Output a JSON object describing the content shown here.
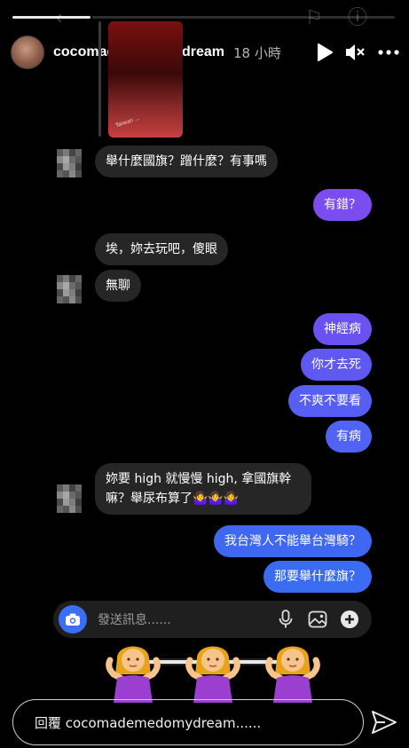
{
  "header": {
    "username": "cocomademedomydream",
    "time": "18 小時"
  },
  "messages": [
    {
      "side": "in",
      "text": "舉什麼國旗？蹭什麼？有事嗎"
    },
    {
      "side": "out",
      "text": "有錯？"
    },
    {
      "side": "in",
      "text": "埃，妳去玩吧，傻眼"
    },
    {
      "side": "in",
      "text": "無聊"
    },
    {
      "side": "out",
      "text": "神經病"
    },
    {
      "side": "out",
      "text": "你才去死"
    },
    {
      "side": "out",
      "text": "不爽不要看"
    },
    {
      "side": "out",
      "text": "有病"
    },
    {
      "side": "in",
      "text": "妳要 high 就慢慢 high, 拿國旗幹嘛？舉尿布算了🤷‍♀️🤷‍♀️🤷‍♀️"
    },
    {
      "side": "out",
      "text": "我台灣人不能舉台灣騎？"
    },
    {
      "side": "out",
      "text": "那要舉什麼旗？"
    }
  ],
  "shared_image_caption": "Taiwan ...",
  "composer": {
    "placeholder": "發送訊息......"
  },
  "reply": {
    "placeholder": "回覆 cocomademedomydream......"
  },
  "colors": {
    "outgoing": "#5a5ff3",
    "incoming": "#262626",
    "camera": "#3b6ef5"
  },
  "icons": [
    "flag-icon",
    "info-icon",
    "play-icon",
    "mute-icon",
    "more-icon",
    "camera-icon",
    "mic-icon",
    "image-icon",
    "plus-icon",
    "send-icon"
  ]
}
